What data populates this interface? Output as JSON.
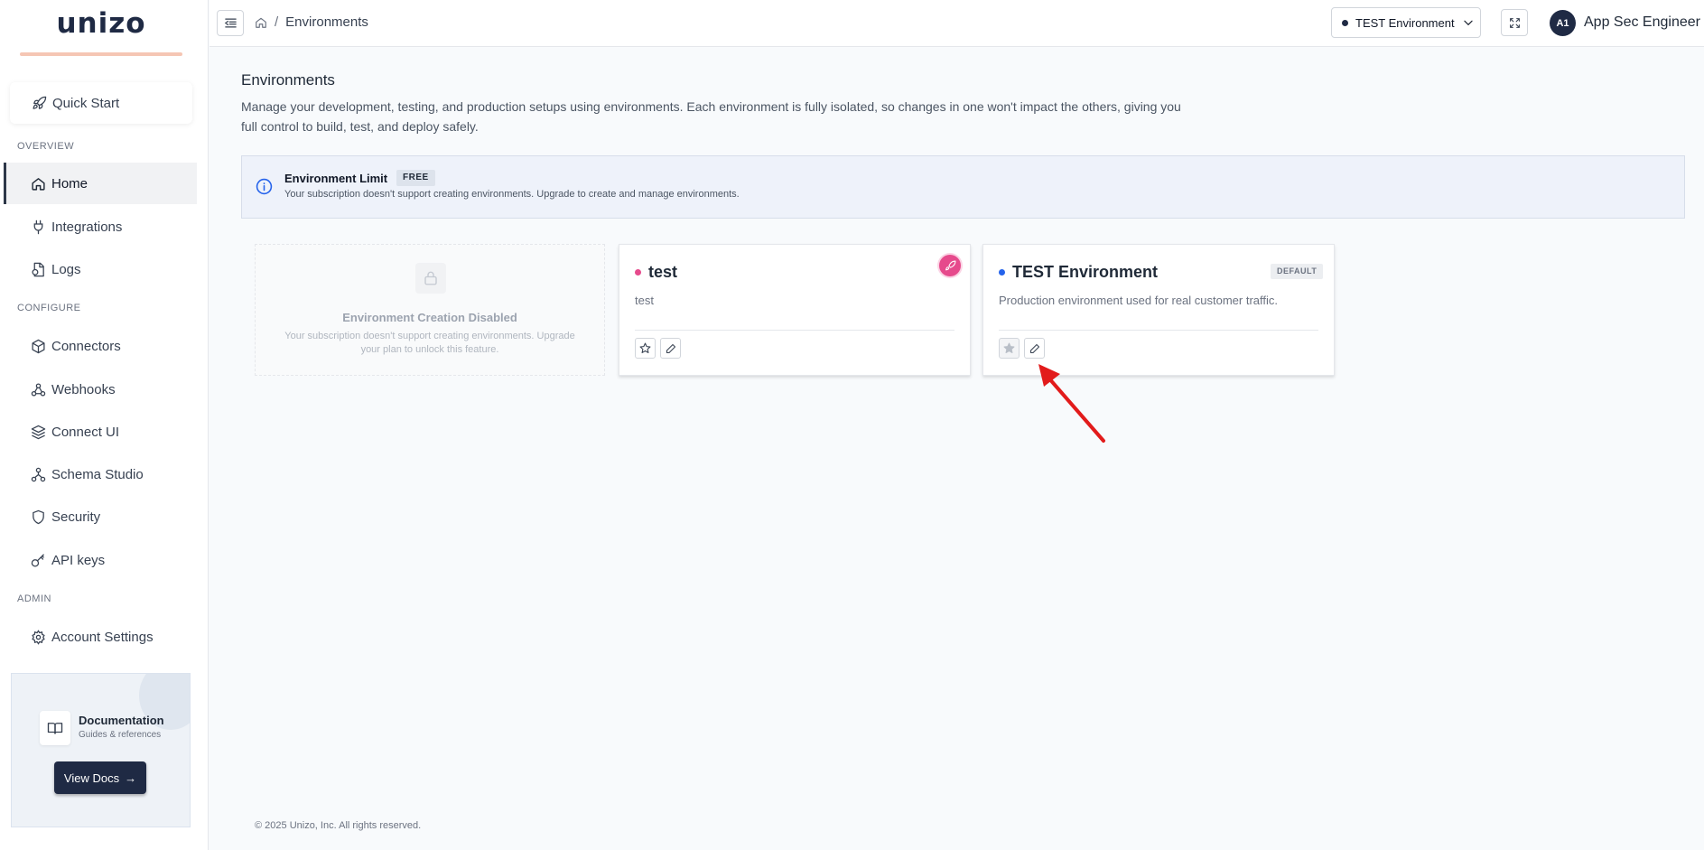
{
  "brand": {
    "logo_text": "unizo"
  },
  "sidebar": {
    "quick_start": "Quick Start",
    "sections": {
      "overview": "OVERVIEW",
      "configure": "CONFIGURE",
      "admin": "ADMIN"
    },
    "items": [
      {
        "label": "Home",
        "icon": "home-icon",
        "active": true
      },
      {
        "label": "Integrations",
        "icon": "plug-icon"
      },
      {
        "label": "Logs",
        "icon": "logs-icon"
      },
      {
        "label": "Connectors",
        "icon": "box-icon"
      },
      {
        "label": "Webhooks",
        "icon": "webhook-icon"
      },
      {
        "label": "Connect UI",
        "icon": "layers-icon"
      },
      {
        "label": "Schema Studio",
        "icon": "schema-icon"
      },
      {
        "label": "Security",
        "icon": "shield-icon"
      },
      {
        "label": "API keys",
        "icon": "key-icon"
      },
      {
        "label": "Account Settings",
        "icon": "gear-icon"
      }
    ],
    "docs": {
      "title": "Documentation",
      "subtitle": "Guides & references",
      "button": "View Docs"
    }
  },
  "topbar": {
    "breadcrumb": {
      "current": "Environments"
    },
    "env_selector": "TEST Environment",
    "user": {
      "initials": "A1",
      "name": "App Sec Engineer"
    }
  },
  "main": {
    "title": "Environments",
    "description": "Manage your development, testing, and production setups using environments. Each environment is fully isolated, so changes in one won't impact the others, giving you full control to build, test, and deploy safely.",
    "alert": {
      "title": "Environment Limit",
      "badge": "FREE",
      "text": "Your subscription doesn't support creating environments. Upgrade to create and manage environments."
    },
    "create_card": {
      "title": "Environment Creation Disabled",
      "text": "Your subscription doesn't support creating environments. Upgrade your plan to unlock this feature."
    },
    "environments": [
      {
        "name": "test",
        "description": "test",
        "dot_color": "#e64a8c",
        "badge": ""
      },
      {
        "name": "TEST Environment",
        "description": "Production environment used for real customer traffic.",
        "dot_color": "#2563eb",
        "badge": "DEFAULT"
      }
    ]
  },
  "footer": {
    "copyright": "© 2025 Unizo, Inc. All rights reserved."
  }
}
